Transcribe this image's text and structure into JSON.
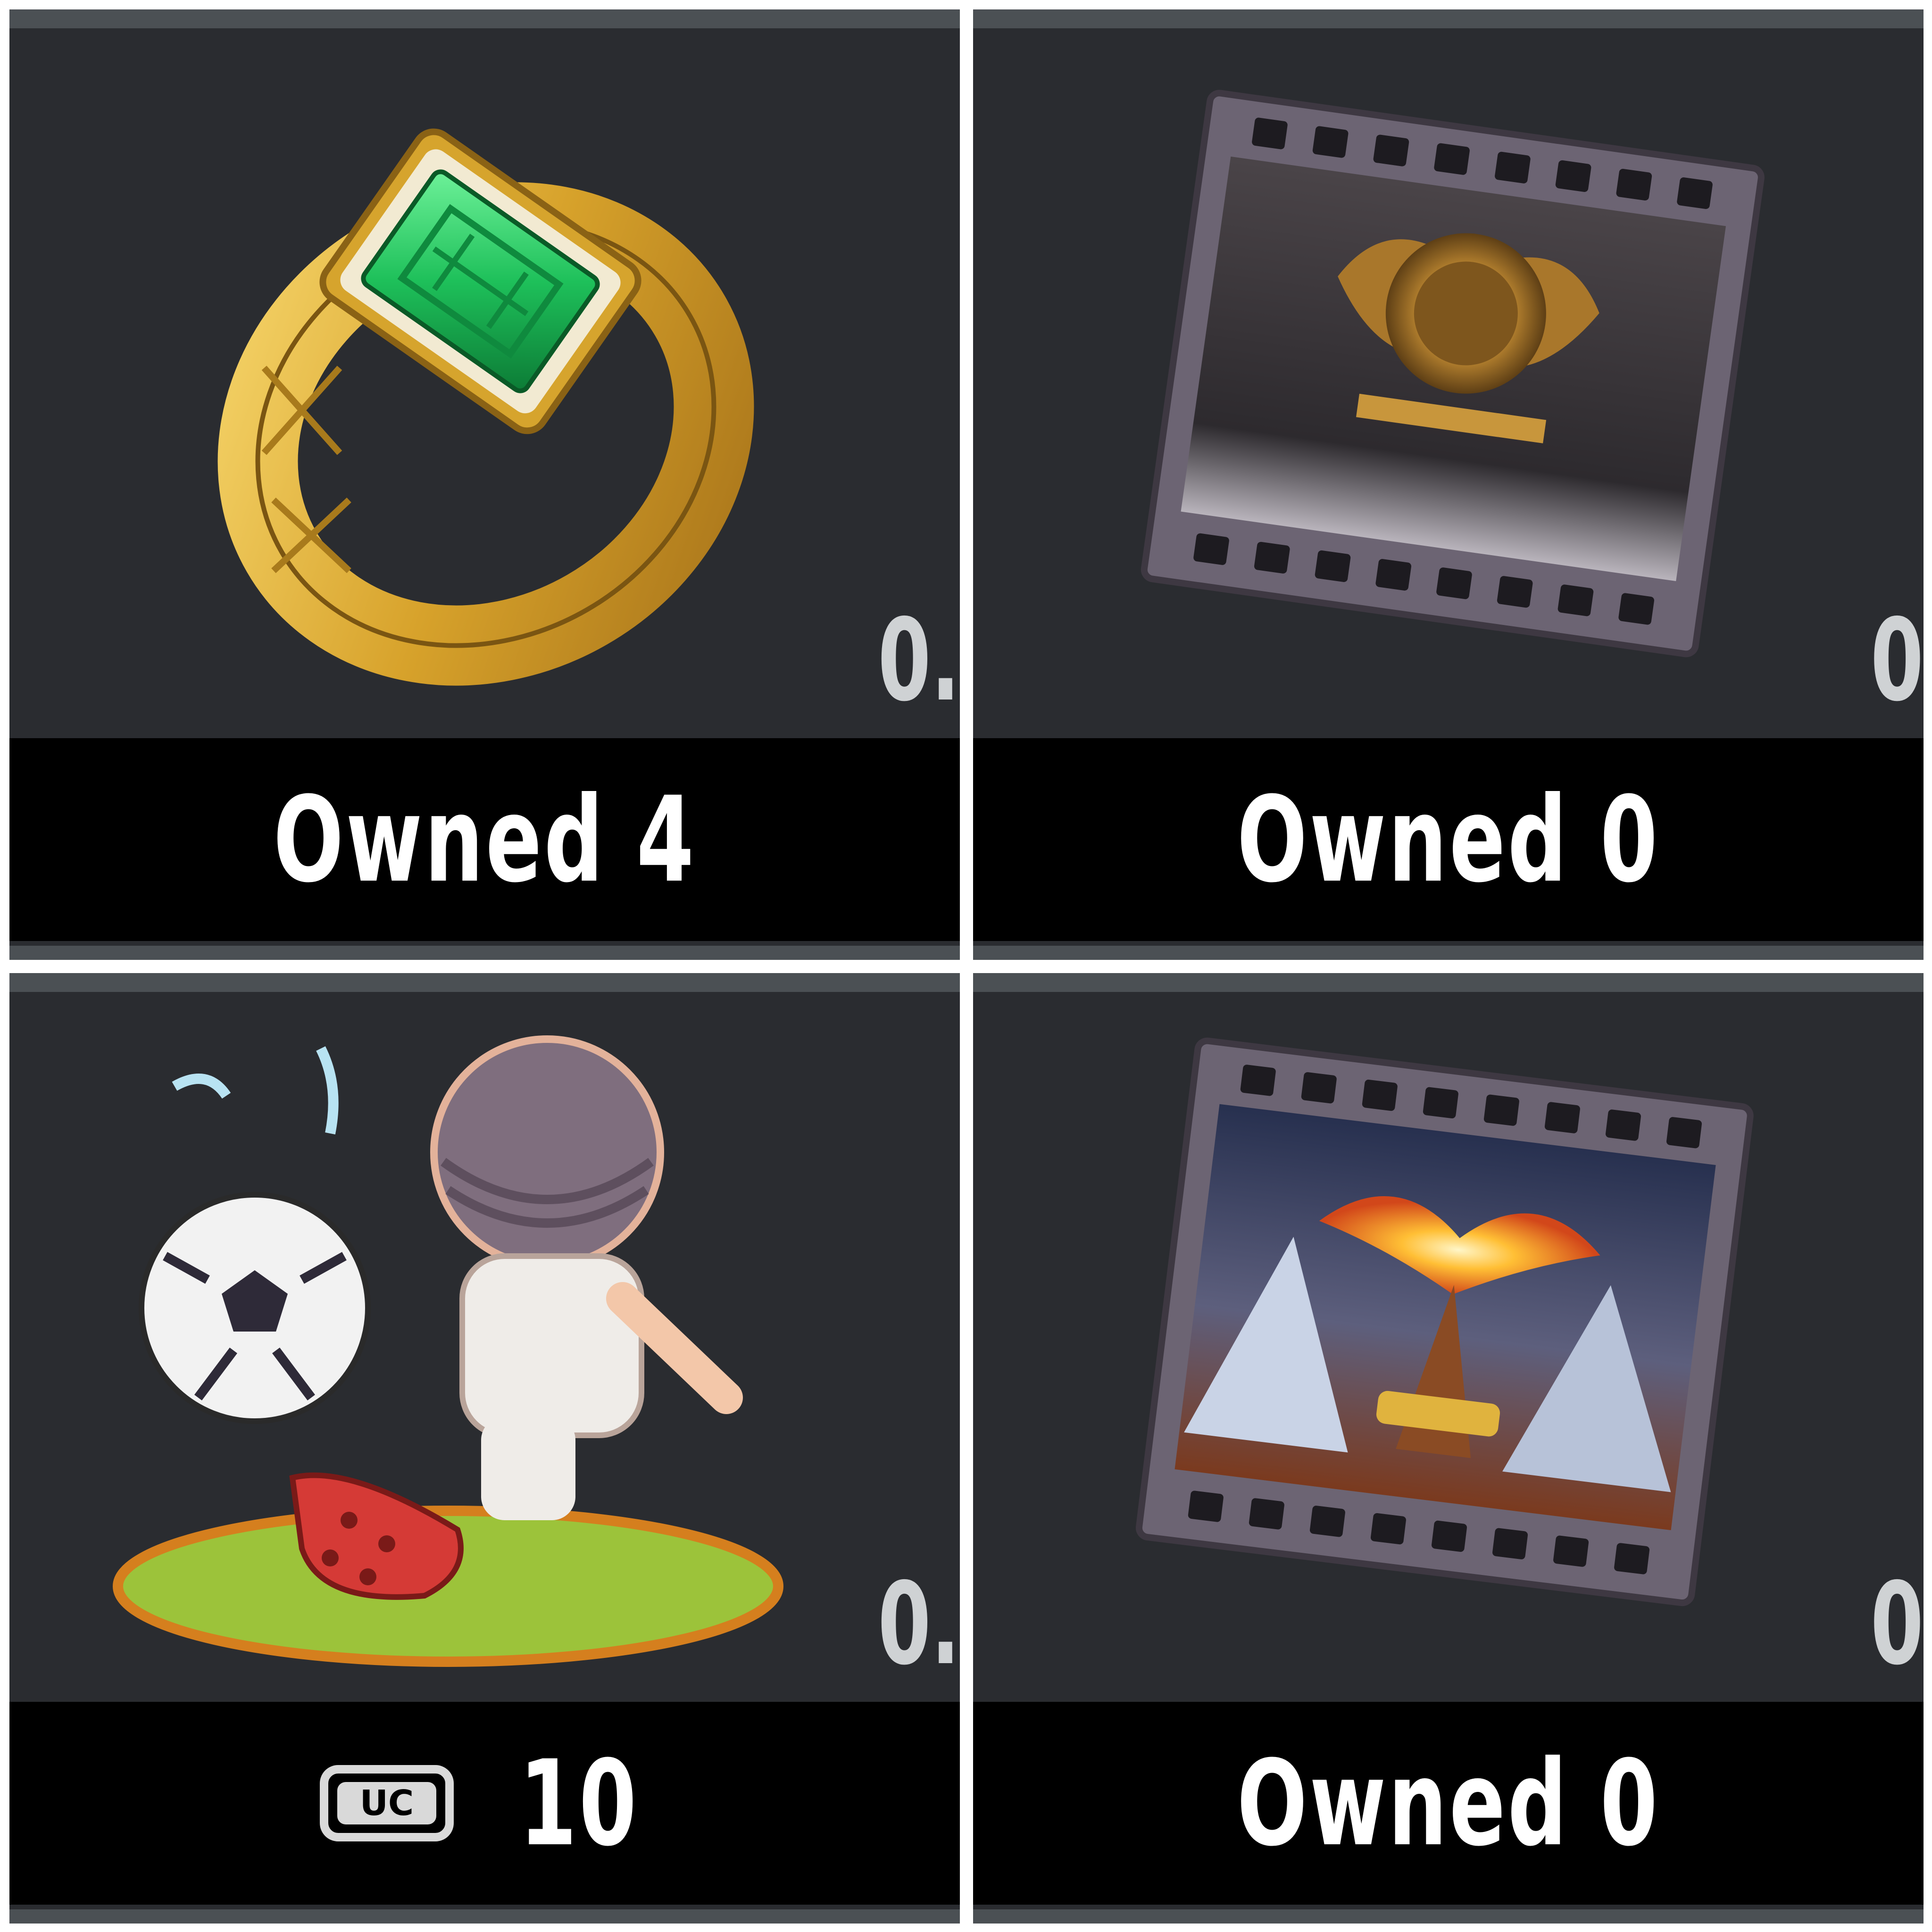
{
  "items": [
    {
      "name": "emerald-ring",
      "icon": "ring-icon",
      "status": "Owned 4",
      "edge_text": "0."
    },
    {
      "name": "film-opening-golden-lion",
      "icon": "film-reel-icon",
      "status": "Owned 0",
      "edge_text": "0"
    },
    {
      "name": "soccer-sticker",
      "icon": "soccer-player-icon",
      "price": "10",
      "currency_label": "UC",
      "currency_icon": "uc-currency-icon",
      "edge_text": "0."
    },
    {
      "name": "film-opening-phoenix",
      "icon": "film-reel-icon",
      "status": "Owned 0",
      "edge_text": "0"
    }
  ],
  "colors": {
    "card_bg": "#2a2c30",
    "footer_bg": "#000000",
    "border": "#4b5054",
    "text": "#ffffff"
  }
}
